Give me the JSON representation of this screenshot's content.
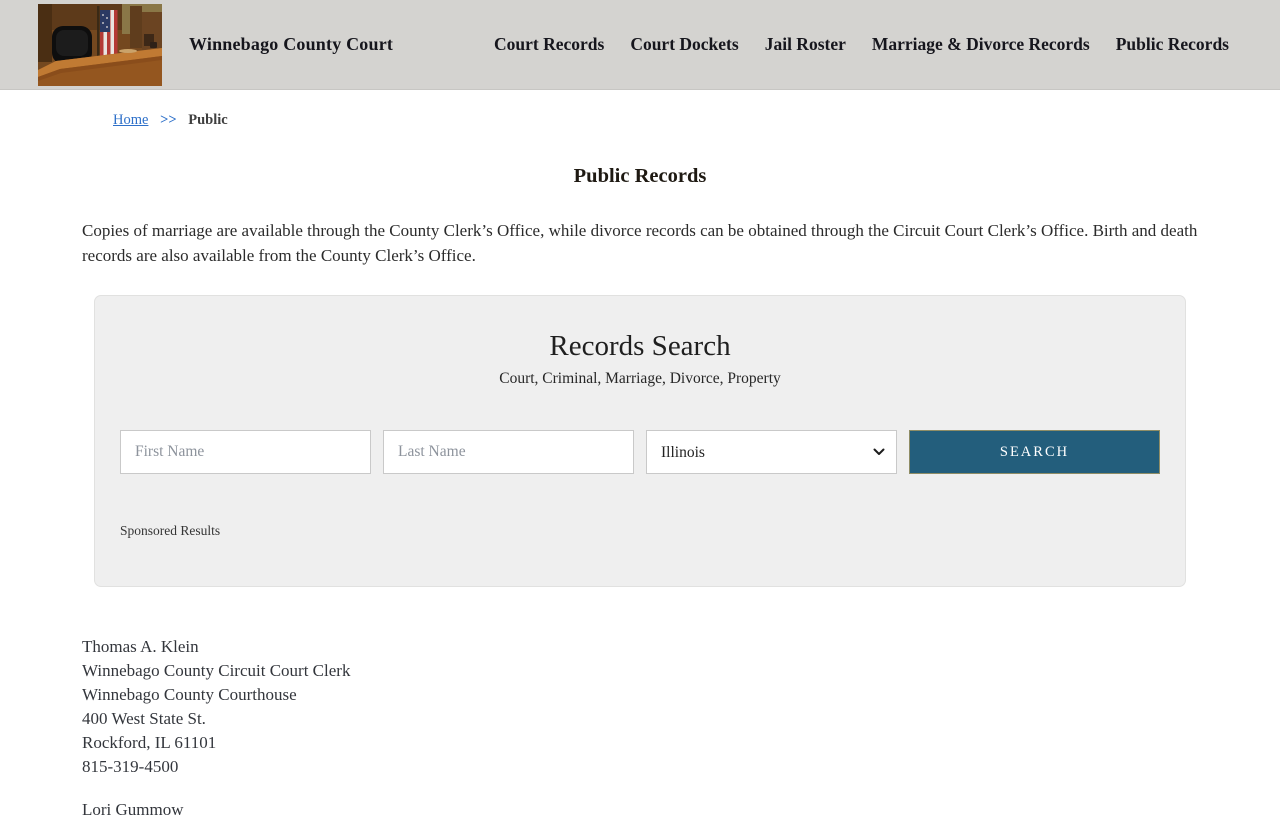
{
  "header": {
    "site_title": "Winnebago County Court",
    "logo": "courtroom-photo",
    "nav": [
      {
        "label": "Court Records"
      },
      {
        "label": "Court Dockets"
      },
      {
        "label": "Jail Roster"
      },
      {
        "label": "Marriage & Divorce Records"
      },
      {
        "label": "Public Records"
      }
    ]
  },
  "breadcrumb": {
    "home_label": "Home",
    "separator": ">>",
    "current_label": "Public"
  },
  "page": {
    "title": "Public Records",
    "intro": "Copies of marriage are available through the County Clerk’s Office, while divorce records can be obtained through the Circuit Court Clerk’s Office. Birth and death records are also available from the County Clerk’s Office."
  },
  "search_panel": {
    "title": "Records Search",
    "subtitle": "Court, Criminal, Marriage, Divorce, Property",
    "first_name_placeholder": "First Name",
    "last_name_placeholder": "Last Name",
    "state_selected": "Illinois",
    "search_button_label": "SEARCH",
    "sponsored_label": "Sponsored Results"
  },
  "contacts": [
    {
      "lines": [
        "Thomas A. Klein",
        "Winnebago County Circuit Court Clerk",
        "Winnebago County Courthouse",
        "400 West State St.",
        "Rockford, IL 61101",
        "815-319-4500"
      ]
    },
    {
      "lines": [
        "Lori Gummow"
      ]
    }
  ],
  "colors": {
    "header_bg": "#d4d3d0",
    "panel_bg": "#efefef",
    "button_blue": "#235e7c",
    "link_blue": "#2e70c9"
  }
}
